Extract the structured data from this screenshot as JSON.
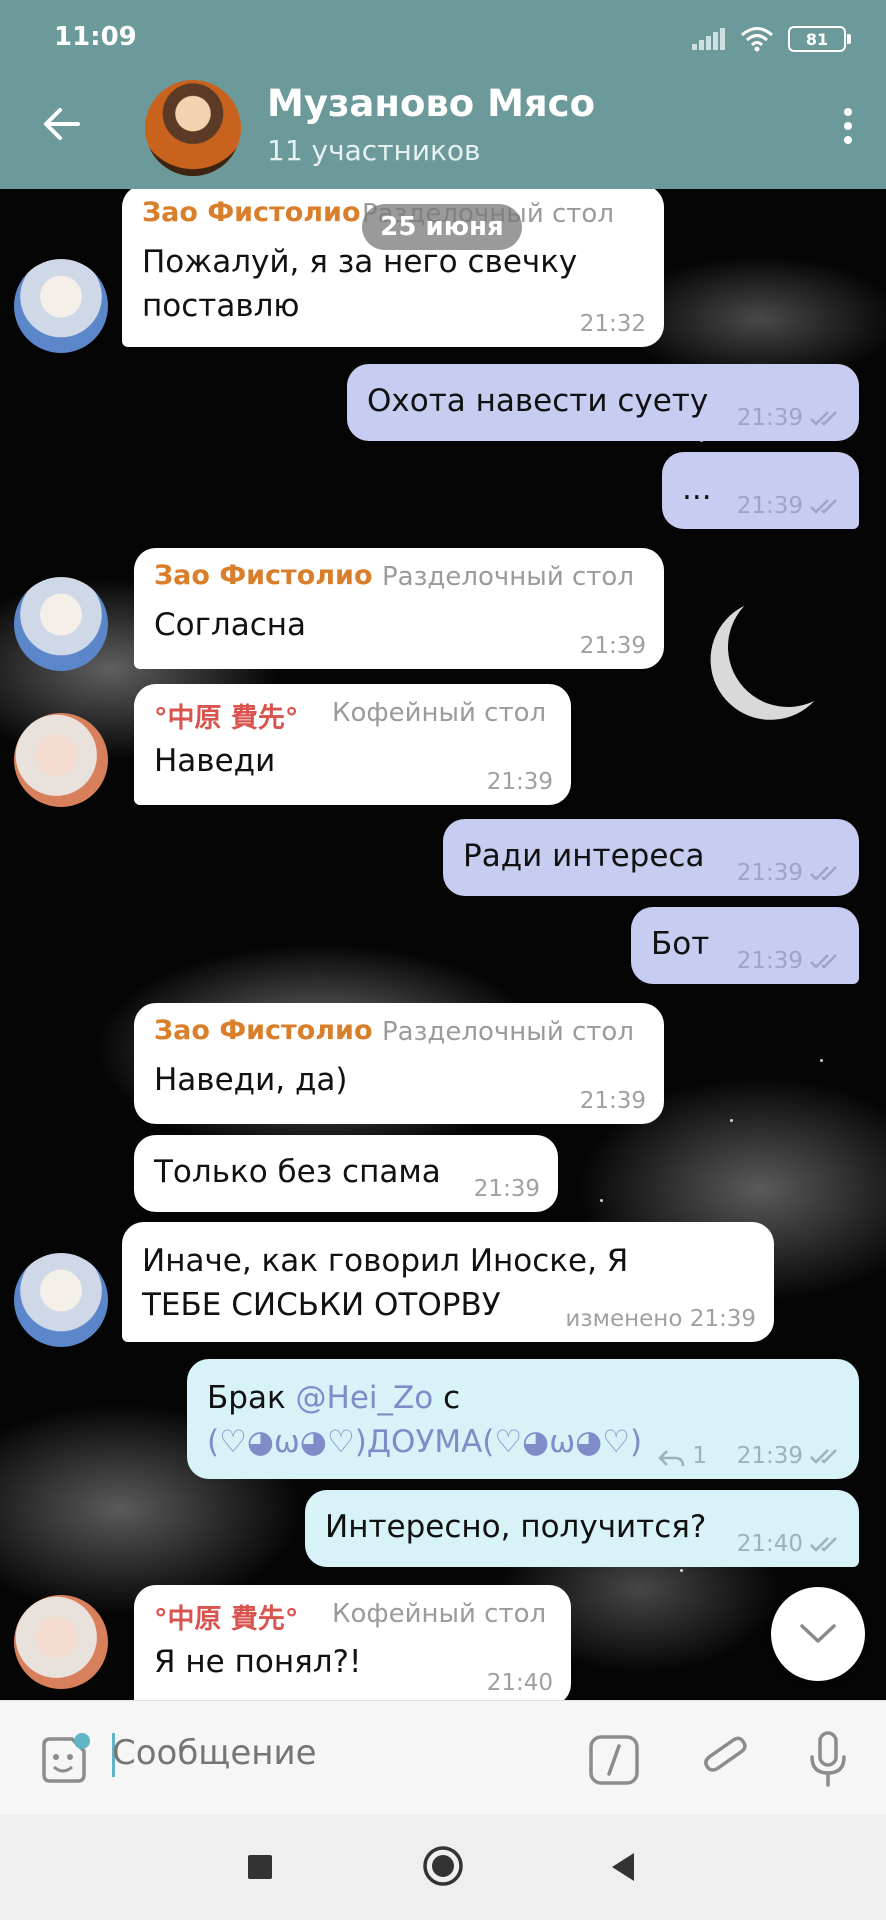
{
  "status_bar": {
    "time": "11:09",
    "battery": "81"
  },
  "header": {
    "title": "Музаново Мясо",
    "subtitle": "11 участников"
  },
  "chat": {
    "date": "25 июня",
    "messages": [
      {
        "sender": "Зао Фистолио",
        "role": "Разделочный стол",
        "lines": [
          "Пожалуй, я за него свечку",
          "поставлю"
        ],
        "time": "21:32"
      },
      {
        "text": "Охота навести суету",
        "time": "21:39"
      },
      {
        "text": "...",
        "time": "21:39"
      },
      {
        "sender": "Зао Фистолио",
        "role": "Разделочный стол",
        "text": "Согласна",
        "time": "21:39"
      },
      {
        "sender": "°中原 費先°",
        "role": "Кофейный стол",
        "text": "Наведи",
        "time": "21:39"
      },
      {
        "text": "Ради интереса",
        "time": "21:39"
      },
      {
        "text": "Бот",
        "time": "21:39"
      },
      {
        "sender": "Зао Фистолио",
        "role": "Разделочный стол",
        "text": "Наведи, да)",
        "time": "21:39"
      },
      {
        "text": "Только без спама",
        "time": "21:39"
      },
      {
        "lines": [
          "Иначе, как говорил Иноске, Я",
          "ТЕБЕ СИСЬКИ ОТОРВУ"
        ],
        "time": "изменено 21:39"
      },
      {
        "text_before": "Брак ",
        "mention": "@Hei_Zo",
        "text_after": " с",
        "line2": "(♡◕ω◕♡)ДОУМА(♡◕ω◕♡)",
        "replies": "1",
        "time": "21:39"
      },
      {
        "text": "Интересно, получится?",
        "time": "21:40"
      },
      {
        "sender": "°中原 費先°",
        "role": "Кофейный стол",
        "text": "Я не понял?!",
        "time": "21:40"
      }
    ]
  },
  "input": {
    "placeholder": "Сообщение"
  },
  "colors": {
    "header": "#6c9a9a",
    "outgoing": "#c7cdf1",
    "outgoing_alt": "#d7f3f8",
    "sender_zao": "#d97e2a",
    "sender_chu": "#d9534f"
  }
}
